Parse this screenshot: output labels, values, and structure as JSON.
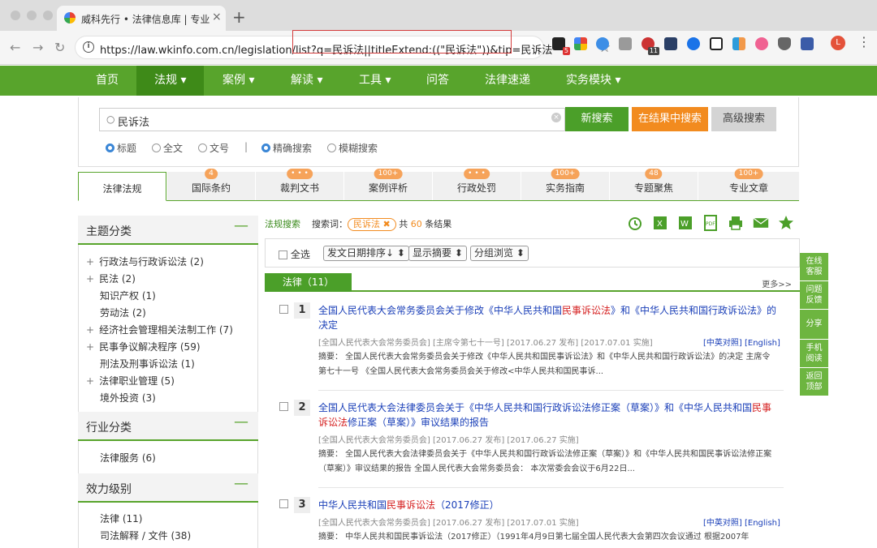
{
  "browser": {
    "tab_title": "威科先行 • 法律信息库 | 专业的",
    "url": "https://law.wkinfo.com.cn/legislation/list?q=民诉法||titleExtend:((\"民诉法\"))&tip=民诉法",
    "ext_badge_1": "5",
    "ext_badge_2": "11",
    "avatar_letter": "L"
  },
  "site_nav": [
    "首页",
    "法规 ▾",
    "案例 ▾",
    "解读 ▾",
    "工具 ▾",
    "问答",
    "法律速递",
    "实务模块 ▾"
  ],
  "search": {
    "value": "民诉法",
    "btn_new": "新搜索",
    "btn_within": "在结果中搜索",
    "btn_adv": "高级搜索",
    "scope_options": [
      "标题",
      "全文",
      "文号"
    ],
    "divider": "|",
    "mode_options": [
      "精确搜索",
      "模糊搜索"
    ]
  },
  "category_tabs": [
    {
      "label": "法律法规",
      "badge": ""
    },
    {
      "label": "国际条约",
      "badge": "4"
    },
    {
      "label": "裁判文书",
      "badge": "• • •"
    },
    {
      "label": "案例评析",
      "badge": "100+"
    },
    {
      "label": "行政处罚",
      "badge": "• • •"
    },
    {
      "label": "实务指南",
      "badge": "100+"
    },
    {
      "label": "专题聚焦",
      "badge": "48"
    },
    {
      "label": "专业文章",
      "badge": "100+"
    }
  ],
  "left_panel": {
    "topic_title": "主题分类",
    "topic_items": [
      {
        "label": "行政法与行政诉讼法 (2)",
        "expand": "+"
      },
      {
        "label": "民法 (2)",
        "expand": "+"
      },
      {
        "label": "知识产权 (1)",
        "expand": ""
      },
      {
        "label": "劳动法 (2)",
        "expand": ""
      },
      {
        "label": "经济社会管理相关法制工作 (7)",
        "expand": "+"
      },
      {
        "label": "民事争议解决程序 (59)",
        "expand": "+"
      },
      {
        "label": "刑法及刑事诉讼法 (1)",
        "expand": ""
      },
      {
        "label": "法律职业管理 (5)",
        "expand": "+"
      },
      {
        "label": "境外投资 (3)",
        "expand": ""
      }
    ],
    "industry_title": "行业分类",
    "industry_items": [
      "法律服务 (6)"
    ],
    "level_title": "效力级别",
    "level_items": [
      "法律 (11)",
      "司法解释 / 文件 (38)"
    ],
    "collapse_symbol": "—"
  },
  "results": {
    "crumb": "法规搜索",
    "kw_label": "搜索词：",
    "keyword": "民诉法 ✖",
    "total_pre": "共",
    "total": "60",
    "total_post": "条结果",
    "select_all": "全选",
    "sort_date": "发文日期排序↓ ⬍",
    "sort_summary": "显示摘要 ⬍",
    "sort_group": "分组浏览 ⬍",
    "section_label": "法律（11）",
    "more": "更多>>",
    "items": [
      {
        "num": "1",
        "title_a": "全国人民代表大会常务委员会关于修改《中华人民共和国",
        "title_red": "民事诉讼法",
        "title_b": "》和《中华人民共和国行政诉讼法》的决定",
        "meta": "[全国人民代表大会常务委员会] [主席令第七十一号] [2017.06.27 发布] [2017.07.01 实施]",
        "lang": "[中英对照] [English]",
        "summary": "摘要：  全国人民代表大会常务委员会关于修改《中华人民共和国民事诉讼法》和《中华人民共和国行政诉讼法》的决定 主席令第七十一号 《全国人民代表大会常务委员会关于修改<中华人民共和国民事诉..."
      },
      {
        "num": "2",
        "title_a": "全国人民代表大会法律委员会关于《中华人民共和国行政诉讼法修正案（草案）》和《中华人民共和国",
        "title_red": "民事诉讼法",
        "title_b": "修正案（草案）》审议结果的报告",
        "meta": "[全国人民代表大会常务委员会] [2017.06.27 发布] [2017.06.27 实施]",
        "lang": "",
        "summary": "摘要：  全国人民代表大会法律委员会关于《中华人民共和国行政诉讼法修正案（草案）》和《中华人民共和国民事诉讼法修正案（草案）》审议结果的报告 全国人民代表大会常务委员会：  本次常委会会议于6月22日..."
      },
      {
        "num": "3",
        "title_a": "中华人民共和国",
        "title_red": "民事诉讼法",
        "title_b": "（2017修正）",
        "meta": "[全国人民代表大会常务委员会] [2017.06.27 发布] [2017.07.01 实施]",
        "lang": "[中英对照] [English]",
        "summary": "摘要：  中华人民共和国民事诉讼法（2017修正）（1991年4月9日第七届全国人民代表大会第四次会议通过   根据2007年"
      }
    ]
  },
  "float_bar": [
    "在线客服",
    "问题反馈",
    "分享",
    "手机阅读",
    "返回顶部"
  ],
  "colors": {
    "brand_green": "#58a42c",
    "active_green": "#3e8a18",
    "orange": "#f28b1f",
    "link_blue": "#1a3fb8",
    "highlight_red": "#d52020"
  }
}
